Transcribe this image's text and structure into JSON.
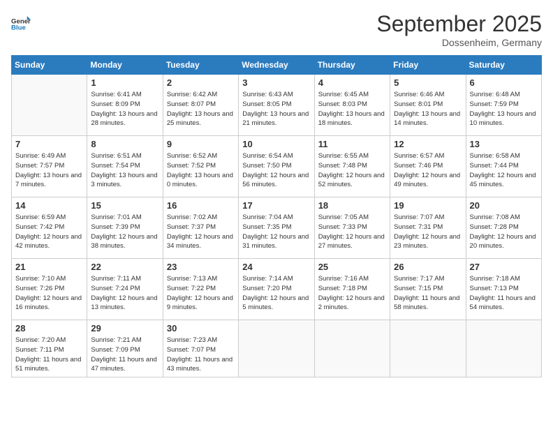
{
  "header": {
    "logo_general": "General",
    "logo_blue": "Blue",
    "month": "September 2025",
    "location": "Dossenheim, Germany"
  },
  "days_of_week": [
    "Sunday",
    "Monday",
    "Tuesday",
    "Wednesday",
    "Thursday",
    "Friday",
    "Saturday"
  ],
  "weeks": [
    [
      {
        "day": "",
        "info": ""
      },
      {
        "day": "1",
        "info": "Sunrise: 6:41 AM\nSunset: 8:09 PM\nDaylight: 13 hours and 28 minutes."
      },
      {
        "day": "2",
        "info": "Sunrise: 6:42 AM\nSunset: 8:07 PM\nDaylight: 13 hours and 25 minutes."
      },
      {
        "day": "3",
        "info": "Sunrise: 6:43 AM\nSunset: 8:05 PM\nDaylight: 13 hours and 21 minutes."
      },
      {
        "day": "4",
        "info": "Sunrise: 6:45 AM\nSunset: 8:03 PM\nDaylight: 13 hours and 18 minutes."
      },
      {
        "day": "5",
        "info": "Sunrise: 6:46 AM\nSunset: 8:01 PM\nDaylight: 13 hours and 14 minutes."
      },
      {
        "day": "6",
        "info": "Sunrise: 6:48 AM\nSunset: 7:59 PM\nDaylight: 13 hours and 10 minutes."
      }
    ],
    [
      {
        "day": "7",
        "info": "Sunrise: 6:49 AM\nSunset: 7:57 PM\nDaylight: 13 hours and 7 minutes."
      },
      {
        "day": "8",
        "info": "Sunrise: 6:51 AM\nSunset: 7:54 PM\nDaylight: 13 hours and 3 minutes."
      },
      {
        "day": "9",
        "info": "Sunrise: 6:52 AM\nSunset: 7:52 PM\nDaylight: 13 hours and 0 minutes."
      },
      {
        "day": "10",
        "info": "Sunrise: 6:54 AM\nSunset: 7:50 PM\nDaylight: 12 hours and 56 minutes."
      },
      {
        "day": "11",
        "info": "Sunrise: 6:55 AM\nSunset: 7:48 PM\nDaylight: 12 hours and 52 minutes."
      },
      {
        "day": "12",
        "info": "Sunrise: 6:57 AM\nSunset: 7:46 PM\nDaylight: 12 hours and 49 minutes."
      },
      {
        "day": "13",
        "info": "Sunrise: 6:58 AM\nSunset: 7:44 PM\nDaylight: 12 hours and 45 minutes."
      }
    ],
    [
      {
        "day": "14",
        "info": "Sunrise: 6:59 AM\nSunset: 7:42 PM\nDaylight: 12 hours and 42 minutes."
      },
      {
        "day": "15",
        "info": "Sunrise: 7:01 AM\nSunset: 7:39 PM\nDaylight: 12 hours and 38 minutes."
      },
      {
        "day": "16",
        "info": "Sunrise: 7:02 AM\nSunset: 7:37 PM\nDaylight: 12 hours and 34 minutes."
      },
      {
        "day": "17",
        "info": "Sunrise: 7:04 AM\nSunset: 7:35 PM\nDaylight: 12 hours and 31 minutes."
      },
      {
        "day": "18",
        "info": "Sunrise: 7:05 AM\nSunset: 7:33 PM\nDaylight: 12 hours and 27 minutes."
      },
      {
        "day": "19",
        "info": "Sunrise: 7:07 AM\nSunset: 7:31 PM\nDaylight: 12 hours and 23 minutes."
      },
      {
        "day": "20",
        "info": "Sunrise: 7:08 AM\nSunset: 7:28 PM\nDaylight: 12 hours and 20 minutes."
      }
    ],
    [
      {
        "day": "21",
        "info": "Sunrise: 7:10 AM\nSunset: 7:26 PM\nDaylight: 12 hours and 16 minutes."
      },
      {
        "day": "22",
        "info": "Sunrise: 7:11 AM\nSunset: 7:24 PM\nDaylight: 12 hours and 13 minutes."
      },
      {
        "day": "23",
        "info": "Sunrise: 7:13 AM\nSunset: 7:22 PM\nDaylight: 12 hours and 9 minutes."
      },
      {
        "day": "24",
        "info": "Sunrise: 7:14 AM\nSunset: 7:20 PM\nDaylight: 12 hours and 5 minutes."
      },
      {
        "day": "25",
        "info": "Sunrise: 7:16 AM\nSunset: 7:18 PM\nDaylight: 12 hours and 2 minutes."
      },
      {
        "day": "26",
        "info": "Sunrise: 7:17 AM\nSunset: 7:15 PM\nDaylight: 11 hours and 58 minutes."
      },
      {
        "day": "27",
        "info": "Sunrise: 7:18 AM\nSunset: 7:13 PM\nDaylight: 11 hours and 54 minutes."
      }
    ],
    [
      {
        "day": "28",
        "info": "Sunrise: 7:20 AM\nSunset: 7:11 PM\nDaylight: 11 hours and 51 minutes."
      },
      {
        "day": "29",
        "info": "Sunrise: 7:21 AM\nSunset: 7:09 PM\nDaylight: 11 hours and 47 minutes."
      },
      {
        "day": "30",
        "info": "Sunrise: 7:23 AM\nSunset: 7:07 PM\nDaylight: 11 hours and 43 minutes."
      },
      {
        "day": "",
        "info": ""
      },
      {
        "day": "",
        "info": ""
      },
      {
        "day": "",
        "info": ""
      },
      {
        "day": "",
        "info": ""
      }
    ]
  ]
}
